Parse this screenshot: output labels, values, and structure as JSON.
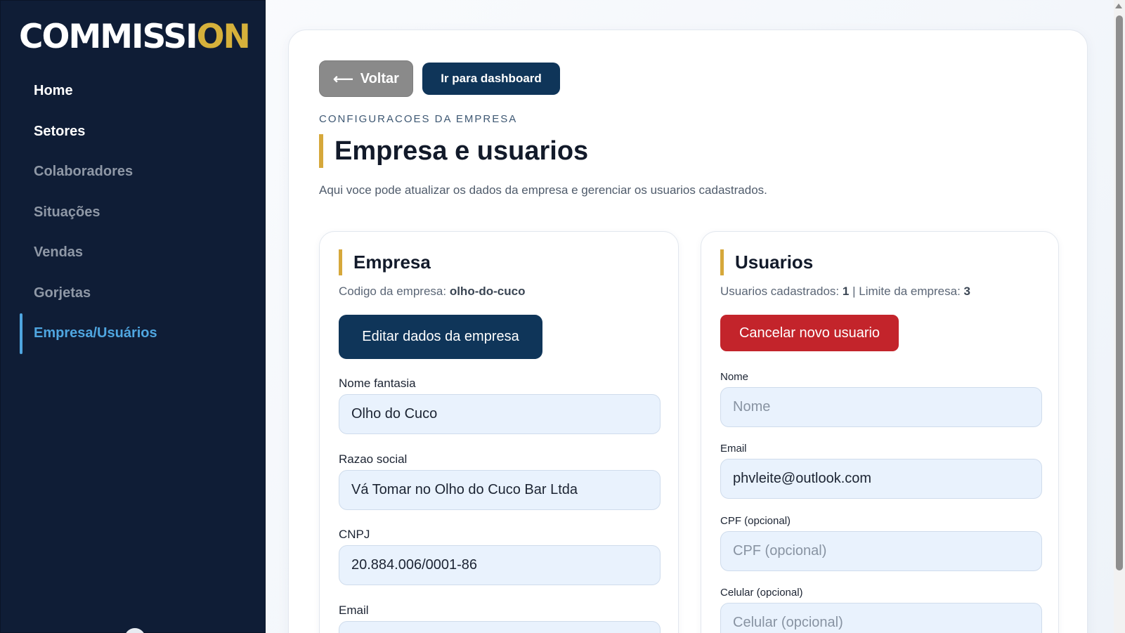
{
  "sidebar": {
    "logo_main": "COMMISSI",
    "logo_accent": "ON",
    "items": [
      {
        "label": "Home"
      },
      {
        "label": "Setores"
      },
      {
        "label": "Colaboradores"
      },
      {
        "label": "Situações"
      },
      {
        "label": "Vendas"
      },
      {
        "label": "Gorjetas"
      },
      {
        "label": "Empresa/Usuários"
      }
    ]
  },
  "header": {
    "back_label": "Voltar",
    "back_arrow": "⟵",
    "dashboard_label": "Ir para dashboard",
    "eyebrow": "CONFIGURACOES DA EMPRESA",
    "title": "Empresa e usuarios",
    "subtitle": "Aqui voce pode atualizar os dados da empresa e gerenciar os usuarios cadastrados."
  },
  "empresa": {
    "title": "Empresa",
    "code_label": "Codigo da empresa:",
    "code_value": "olho-do-cuco",
    "edit_button": "Editar dados da empresa",
    "fields": [
      {
        "label": "Nome fantasia",
        "value": "Olho do Cuco"
      },
      {
        "label": "Razao social",
        "value": "Vá Tomar no Olho do Cuco Bar Ltda"
      },
      {
        "label": "CNPJ",
        "value": "20.884.006/0001-86"
      },
      {
        "label": "Email",
        "value": ""
      }
    ]
  },
  "usuarios": {
    "title": "Usuarios",
    "count_label": "Usuarios cadastrados:",
    "count_value": "1",
    "separator": "|",
    "limit_label": "Limite da empresa:",
    "limit_value": "3",
    "cancel_button": "Cancelar novo usuario",
    "fields": [
      {
        "label": "Nome",
        "value": "",
        "placeholder": "Nome"
      },
      {
        "label": "Email",
        "value": "phvleite@outlook.com",
        "placeholder": ""
      },
      {
        "label": "CPF (opcional)",
        "value": "",
        "placeholder": "CPF (opcional)"
      },
      {
        "label": "Celular (opcional)",
        "value": "",
        "placeholder": "Celular (opcional)"
      }
    ]
  },
  "colors": {
    "sidebar_bg": "#0f1d36",
    "accent_gold": "#d6b13b",
    "active_nav": "#4fa6e0",
    "primary_button": "#0f3559",
    "danger_button": "#c3242b",
    "input_bg": "#e9f2fd"
  }
}
